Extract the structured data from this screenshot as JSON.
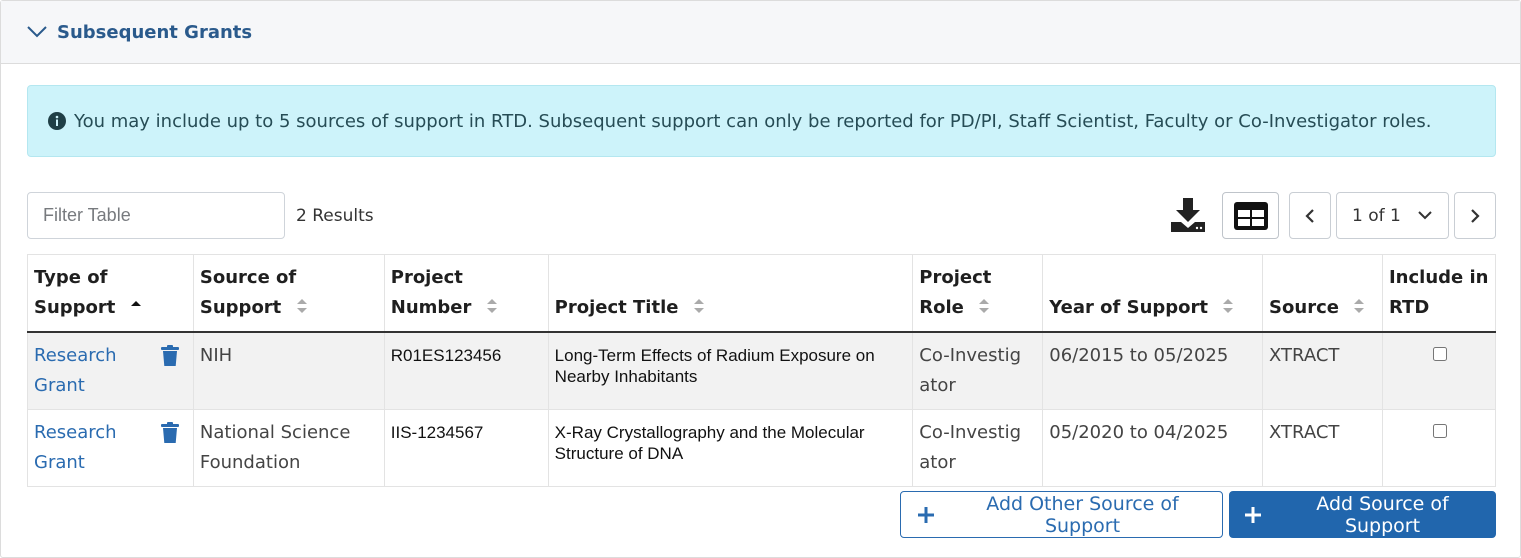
{
  "section": {
    "title": "Subsequent Grants",
    "expanded": true
  },
  "alert": {
    "text": "You may include up to 5 sources of support in RTD. Subsequent support can only be reported for PD/PI, Staff Scientist, Faculty or Co-Investigator roles."
  },
  "toolbar": {
    "filter_placeholder": "Filter Table",
    "results": "2 Results",
    "page_indicator": "1 of 1"
  },
  "table": {
    "columns": [
      {
        "label": "Type of Support",
        "sort": "asc"
      },
      {
        "label": "Source of Support",
        "sort": "none"
      },
      {
        "label": "Project Number",
        "sort": "none"
      },
      {
        "label": "Project Title",
        "sort": "none"
      },
      {
        "label": "Project Role",
        "sort": "none"
      },
      {
        "label": "Year of Support",
        "sort": "none"
      },
      {
        "label": "Source",
        "sort": "none"
      },
      {
        "label": "Include in RTD",
        "sort": null
      }
    ],
    "rows": [
      {
        "type": "Research Grant",
        "source_of_support": "NIH",
        "project_number": "R01ES123456",
        "project_title": "Long-Term Effects of Radium Exposure on Nearby Inhabitants",
        "project_role": "Co-Investigator",
        "year_of_support": "06/2015 to 05/2025",
        "source": "XTRACT",
        "include_in_rtd": false
      },
      {
        "type": "Research Grant",
        "source_of_support": "National Science Foundation",
        "project_number": "IIS-1234567",
        "project_title": "X-Ray Crystallography and the Molecular Structure of DNA",
        "project_role": "Co-Investigator",
        "year_of_support": "05/2020 to 04/2025",
        "source": "XTRACT",
        "include_in_rtd": false
      }
    ]
  },
  "actions": {
    "add_other": "Add Other Source of Support",
    "add_source": "Add Source of Support"
  },
  "colors": {
    "link": "#2a6bb0",
    "primary": "#2166ad",
    "alert_bg": "#cdf3fa",
    "header_bg": "#f6f7f9"
  },
  "icons": [
    "chevron-down-icon",
    "info-icon",
    "download-icon",
    "table-view-icon",
    "chevron-left-icon",
    "chevron-right-icon",
    "trash-icon",
    "plus-icon",
    "sort-icon"
  ]
}
